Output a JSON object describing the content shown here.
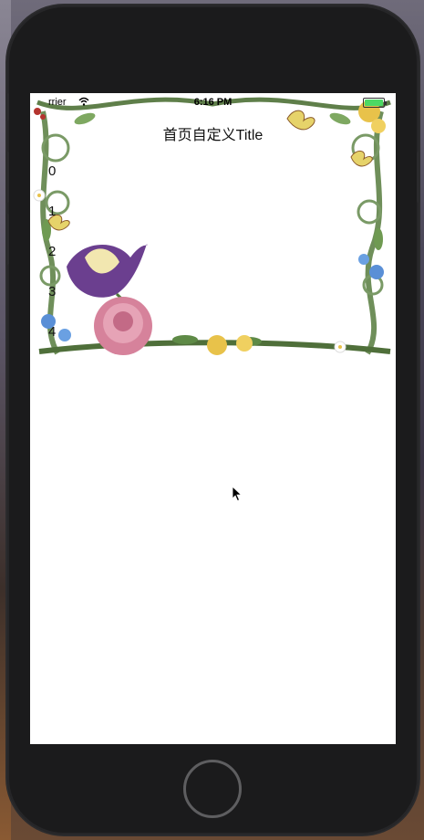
{
  "status_bar": {
    "carrier": "rrier",
    "time": "6:16 PM"
  },
  "nav": {
    "title": "首页自定义Title"
  },
  "index_list": {
    "items": [
      "0",
      "1",
      "2",
      "3",
      "4"
    ]
  },
  "colors": {
    "screen_background": "#ffffff",
    "phone_body": "#1b1b1c",
    "battery": "#4cd964"
  },
  "icons": {
    "wifi": "wifi-icon",
    "battery": "battery-icon",
    "cursor": "mouse-cursor-icon",
    "home": "home-button"
  }
}
